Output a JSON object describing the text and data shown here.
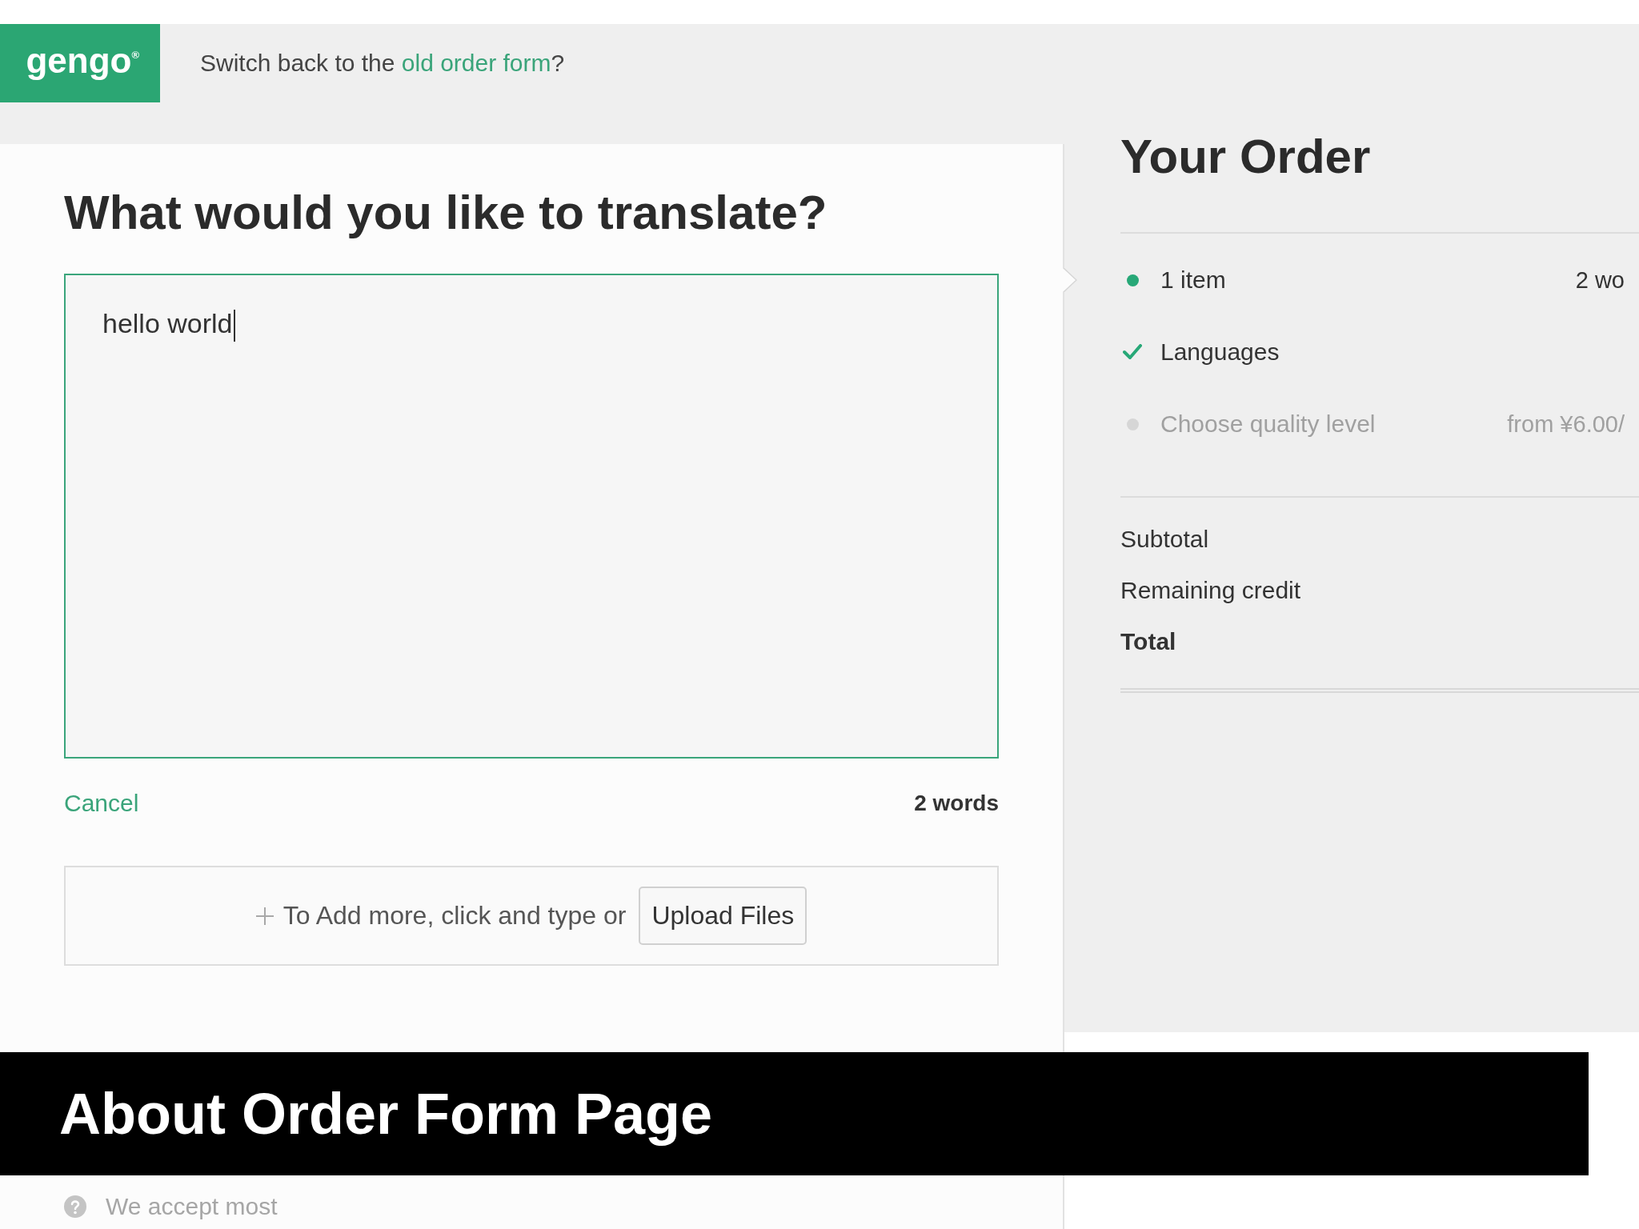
{
  "header": {
    "logo": "gengo$^{®}$",
    "switch_back": {
      "prefix": "Switch back to the",
      "link": "old order form",
      "suffix": "?"
    }
  },
  "form": {
    "title": "What would you like to translate?",
    "textarea": {
      "value": "hello world",
      "focused": true
    },
    "cancel": "Cancel",
    "word_count": "2 words",
    "add_more": {
      "text": "To Add more, click and type or",
      "button": "Upload Files"
    },
    "help_note": "We accept most"
  },
  "order": {
    "title": "Your Order",
    "steps": [
      {
        "label": "1 item",
        "value": "2 wo",
        "checked": false,
        "disabled": false
      },
      {
        "label": "Languages",
        "checked": true,
        "disabled": false
      },
      {
        "label": "Choose quality level",
        "value": "from ¥6.00/",
        "checked": false,
        "disabled": true
      }
    ],
    "totals": [
      {
        "label": "Subtotal",
        "kind": "line"
      },
      {
        "label": "Remaining credit",
        "kind": "line"
      },
      {
        "label": "Total",
        "kind": "total"
      }
    ]
  },
  "caption": "About Order Form Page"
}
